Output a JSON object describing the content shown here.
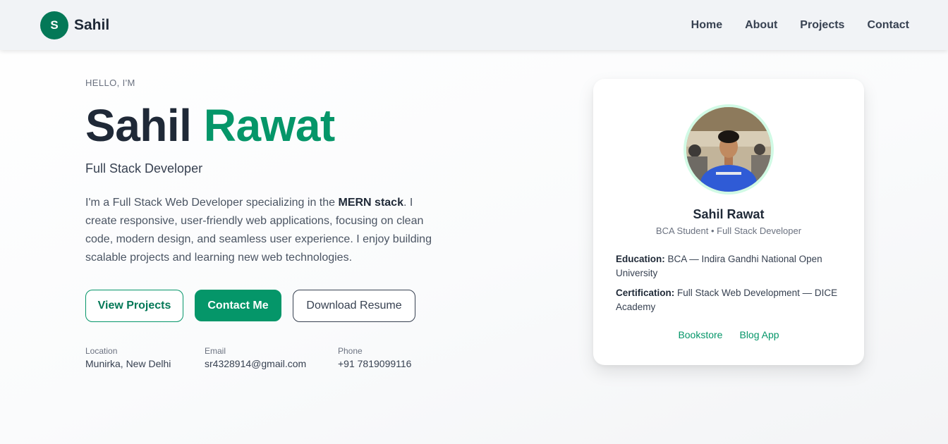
{
  "nav": {
    "brand_initial": "S",
    "brand_name": "Sahil",
    "links": [
      "Home",
      "About",
      "Projects",
      "Contact"
    ]
  },
  "hero": {
    "eyebrow": "HELLO, I'M",
    "first_name": "Sahil",
    "last_name": "Rawat",
    "role": "Full Stack Developer",
    "bio_before": "I'm a Full Stack Web Developer specializing in the ",
    "bio_bold": "MERN stack",
    "bio_after": ". I create responsive, user-friendly web applications, focusing on clean code, modern design, and seamless user experience. I enjoy building scalable projects and learning new web technologies.",
    "buttons": {
      "view_projects": "View Projects",
      "contact_me": "Contact Me",
      "download_resume": "Download Resume"
    },
    "info": {
      "location_label": "Location",
      "location_value": "Munirka, New Delhi",
      "email_label": "Email",
      "email_value": "sr4328914@gmail.com",
      "phone_label": "Phone",
      "phone_value": "+91 7819099116"
    }
  },
  "card": {
    "name": "Sahil Rawat",
    "subtitle": "BCA Student • Full Stack Developer",
    "education_label": "Education:",
    "education_value": " BCA — Indira Gandhi National Open University",
    "certification_label": "Certification:",
    "certification_value": " Full Stack Web Development — DICE Academy",
    "links": [
      "Bookstore",
      "Blog App"
    ]
  },
  "colors": {
    "accent": "#059669",
    "accent_dark": "#047857",
    "text_dark": "#1f2937",
    "avatar_ring": "#d1fae5"
  }
}
